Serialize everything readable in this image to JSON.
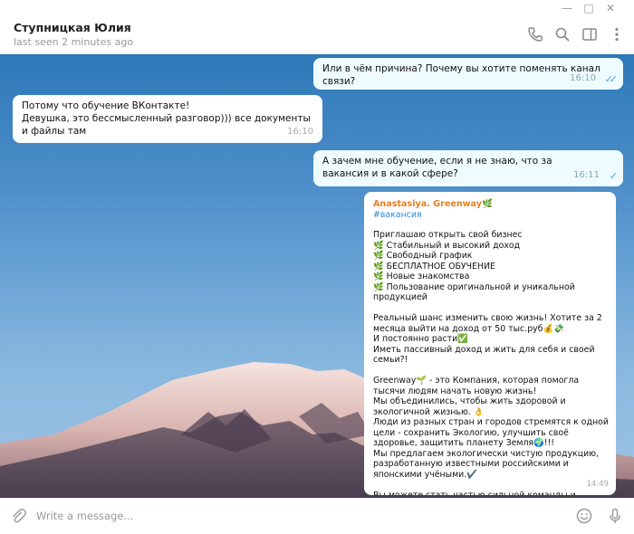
{
  "window": {
    "controls": [
      "minimize-icon",
      "maximize-icon",
      "close-icon"
    ],
    "minimize_glyph": "—",
    "maximize_glyph": "□",
    "close_glyph": "✕"
  },
  "header": {
    "contact_name": "Ступницкая Юлия",
    "status": "last seen 2 minutes ago",
    "icons": [
      "phone-icon",
      "search-icon",
      "sidebar-toggle-icon",
      "more-icon"
    ]
  },
  "messages": [
    {
      "direction": "out",
      "text": "Или в чём причина? Почему вы хотите поменять канал связи?",
      "time": "16:10",
      "read": true
    },
    {
      "direction": "in",
      "text": "Потому что обучение ВКонтакте!\nДевушка, это бессмысленный разговор))) все документы и файлы там",
      "time": "16:10"
    },
    {
      "direction": "out",
      "text": "А зачем мне обучение, если я не знаю, что за вакансия и в какой сфере?",
      "time": "16:11",
      "read": false
    }
  ],
  "forwarded": {
    "sender": "Anastasiya. Greenway🌿",
    "hashtag": "#вакансия",
    "body": "Приглашаю открыть свой бизнес\n🌿 Стабильный и высокий доход\n🌿 Свободный график\n🌿 БЕСПЛАТНОЕ ОБУЧЕНИЕ\n🌿 Новые знакомства\n🌿 Пользование оригинальной и уникальной продукцией\n\nРеальный шанс изменить свою жизнь! Хотите за 2 месяца выйти на доход от 50 тыс.руб💰💸\nИ постоянно расти✅\nИметь пассивный доход и жить для себя и своей семьи?!\n\nGreenway🌱 - это Компания, которая помогла тысячи людям начать новую жизнь!\nМы объединились, чтобы жить здоровой и экологичной жизнью. 👌\nЛюди из разных стран и городов стремятся к одной цели - сохранить Экологию, улучшить своё здоровье, защитить планету Земля🌍!!!\nМы предлагаем экологически чистую продукцию, разработанную известными российскими и японскими учёными.✔️\n\nВы можете стать частью сильной команды и развивать сильный бизнес✅",
    "time": "14:49"
  },
  "composer": {
    "placeholder": "Write a message...",
    "value": "",
    "icons": [
      "attach-icon",
      "emoji-icon",
      "microphone-icon"
    ]
  },
  "colors": {
    "outgoing_bubble": "#eefbff",
    "incoming_bubble": "#ffffff",
    "read_ticks": "#4fa7e0",
    "sender_name": "#e67e22",
    "hashtag": "#2a8ad6"
  }
}
